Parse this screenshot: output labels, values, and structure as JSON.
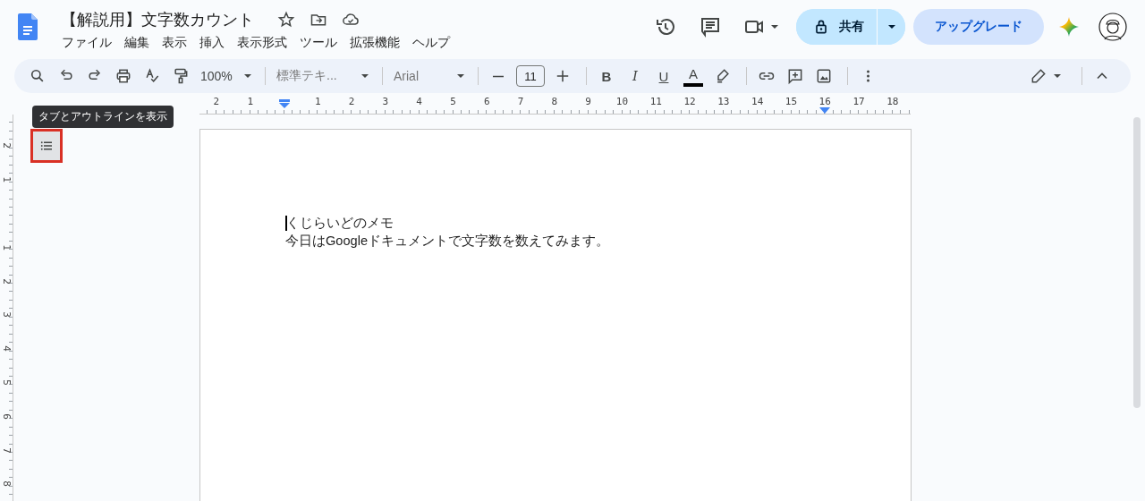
{
  "document": {
    "title": "【解説用】文字数カウント"
  },
  "menu": [
    "ファイル",
    "編集",
    "表示",
    "挿入",
    "表示形式",
    "ツール",
    "拡張機能",
    "ヘルプ"
  ],
  "share_button": {
    "label": "共有"
  },
  "upgrade_button": {
    "label": "アップグレード"
  },
  "toolbar": {
    "zoom": "100%",
    "paragraph_style": "標準テキ...",
    "font": "Arial",
    "font_size": "11",
    "bold": "B",
    "italic": "I",
    "underline": "U",
    "text_color": "A"
  },
  "ruler": {
    "left_labels": [
      "2",
      "1"
    ],
    "labels": [
      "1",
      "2",
      "3",
      "4",
      "5",
      "6",
      "7",
      "8",
      "9",
      "10",
      "11",
      "12",
      "13",
      "14",
      "15",
      "16",
      "17",
      "18"
    ]
  },
  "vertical_ruler": {
    "top_labels": [
      "2",
      "1"
    ],
    "labels": [
      "1",
      "2",
      "3",
      "4",
      "5",
      "6",
      "7",
      "8"
    ]
  },
  "outline_button": {
    "highlighted": true
  },
  "tooltip": "タブとアウトラインを表示",
  "body": {
    "lines": [
      "くじらいどのメモ",
      "今日はGoogleドキュメントで文字数を数えてみます。"
    ]
  }
}
